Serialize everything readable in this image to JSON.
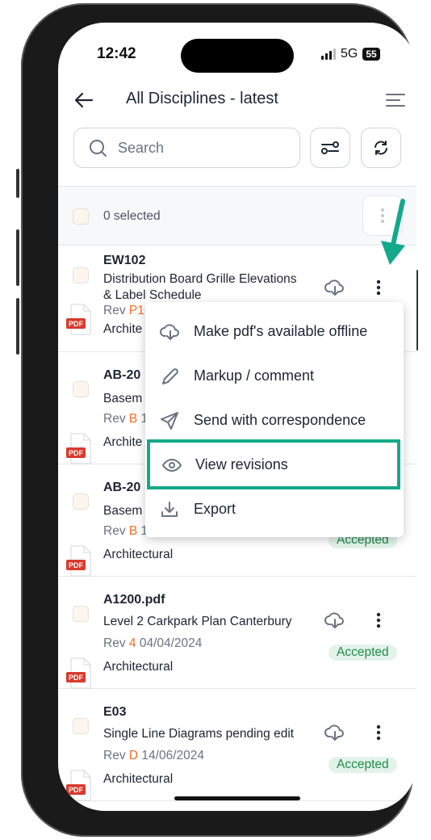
{
  "status_bar": {
    "time": "12:42",
    "network": "5G",
    "battery": "55"
  },
  "header": {
    "title": "All Disciplines - latest"
  },
  "search": {
    "placeholder": "Search"
  },
  "selection": {
    "label": "0 selected"
  },
  "rows": [
    {
      "code": "EW102",
      "title_line1": "Distribution Board Grille Elevations",
      "title_line2": "& Label Schedule",
      "rev_label": "Rev",
      "rev": "P1",
      "date": "",
      "discipline": "Archite",
      "file_type": "PDF"
    },
    {
      "code": "AB-20",
      "title": "Basem",
      "rev_label": "Rev",
      "rev": "B",
      "date": "1",
      "discipline": "Archite",
      "file_type": "PDF"
    },
    {
      "code": "AB-20",
      "title": "Basem",
      "rev_label": "Rev",
      "rev": "B",
      "date": "1",
      "discipline": "Architectural",
      "status": "Accepted",
      "file_type": "PDF"
    },
    {
      "code": "A1200.pdf",
      "title": "Level 2 Carkpark Plan Canterbury",
      "rev_label": "Rev",
      "rev": "4",
      "date": "04/04/2024",
      "discipline": "Architectural",
      "status": "Accepted",
      "file_type": "PDF"
    },
    {
      "code": "E03",
      "title": "Single Line Diagrams pending edit",
      "rev_label": "Rev",
      "rev": "D",
      "date": "14/06/2024",
      "discipline": "Architectural",
      "status": "Accepted",
      "file_type": "PDF"
    }
  ],
  "context_menu": {
    "items": [
      {
        "label": "Make pdf's available offline",
        "icon": "cloud-download-icon"
      },
      {
        "label": "Markup / comment",
        "icon": "pencil-icon"
      },
      {
        "label": "Send with correspondence",
        "icon": "send-icon"
      },
      {
        "label": "View revisions",
        "icon": "eye-icon",
        "highlighted": true
      },
      {
        "label": "Export",
        "icon": "download-icon"
      }
    ]
  },
  "colors": {
    "accent_orange": "#f26c22",
    "highlight_teal": "#14a98a",
    "accepted_green": "#1f8a4c"
  }
}
